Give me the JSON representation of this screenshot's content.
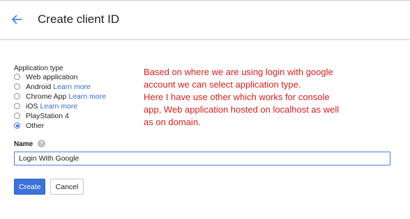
{
  "header": {
    "back_icon": "arrow-left-icon",
    "title": "Create client ID"
  },
  "application_type": {
    "label": "Application type",
    "options": [
      {
        "label": "Web application",
        "link": "",
        "checked": false
      },
      {
        "label": "Android",
        "link": "Learn more",
        "checked": false
      },
      {
        "label": "Chrome App",
        "link": "Learn more",
        "checked": false
      },
      {
        "label": "iOS",
        "link": "Learn more",
        "checked": false
      },
      {
        "label": "PlayStation 4",
        "link": "",
        "checked": false
      },
      {
        "label": "Other",
        "link": "",
        "checked": true
      }
    ]
  },
  "annotation": {
    "lines": [
      "Based on where we are using login with google",
      "account we can select application type.",
      "Here I have use other which works for console",
      "app, Web application hosted on localhost as well",
      "as on domain."
    ],
    "color": "#d81e1e"
  },
  "name_field": {
    "label": "Name",
    "help_icon": "help-circle-icon",
    "value": "Login With Google"
  },
  "actions": {
    "create_label": "Create",
    "cancel_label": "Cancel"
  },
  "colors": {
    "accent": "#3b73d9",
    "link": "#3367d6"
  }
}
